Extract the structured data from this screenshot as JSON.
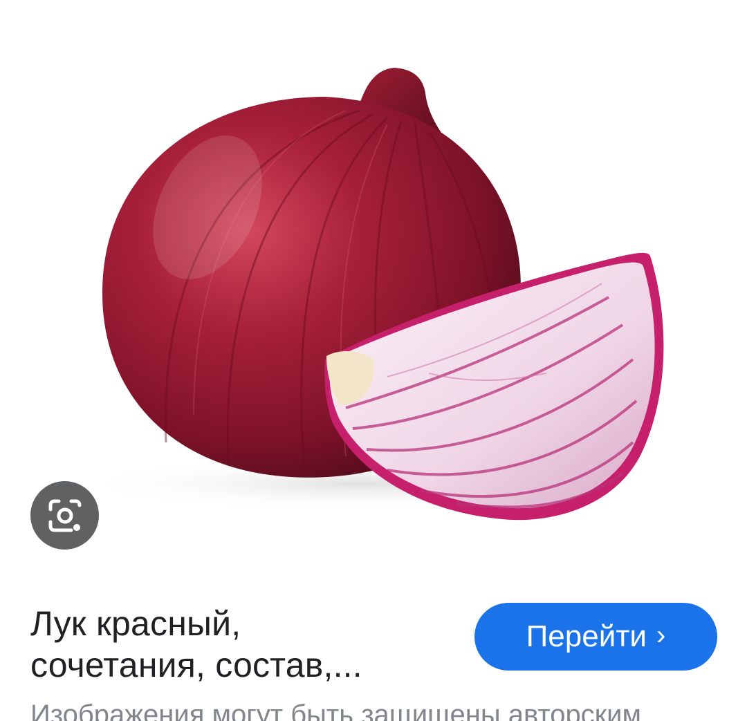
{
  "result": {
    "title_line1": "Лук красный,",
    "title_line2": "сочетания, состав,...",
    "visit_label": "Перейти",
    "visit_chevron": "›",
    "copyright_notice": "Изображения могут быть защищены авторским"
  },
  "image": {
    "subject": "red onion with cut wedge"
  },
  "icons": {
    "lens": "google-lens-icon",
    "chevron": "chevron-right-icon"
  },
  "colors": {
    "accent": "#1a73e8",
    "lens_bg": "#5f6163",
    "title": "#202124",
    "notice": "#80868b",
    "onion_skin": "#8e1a2e",
    "onion_flesh": "#f4dbe9"
  }
}
